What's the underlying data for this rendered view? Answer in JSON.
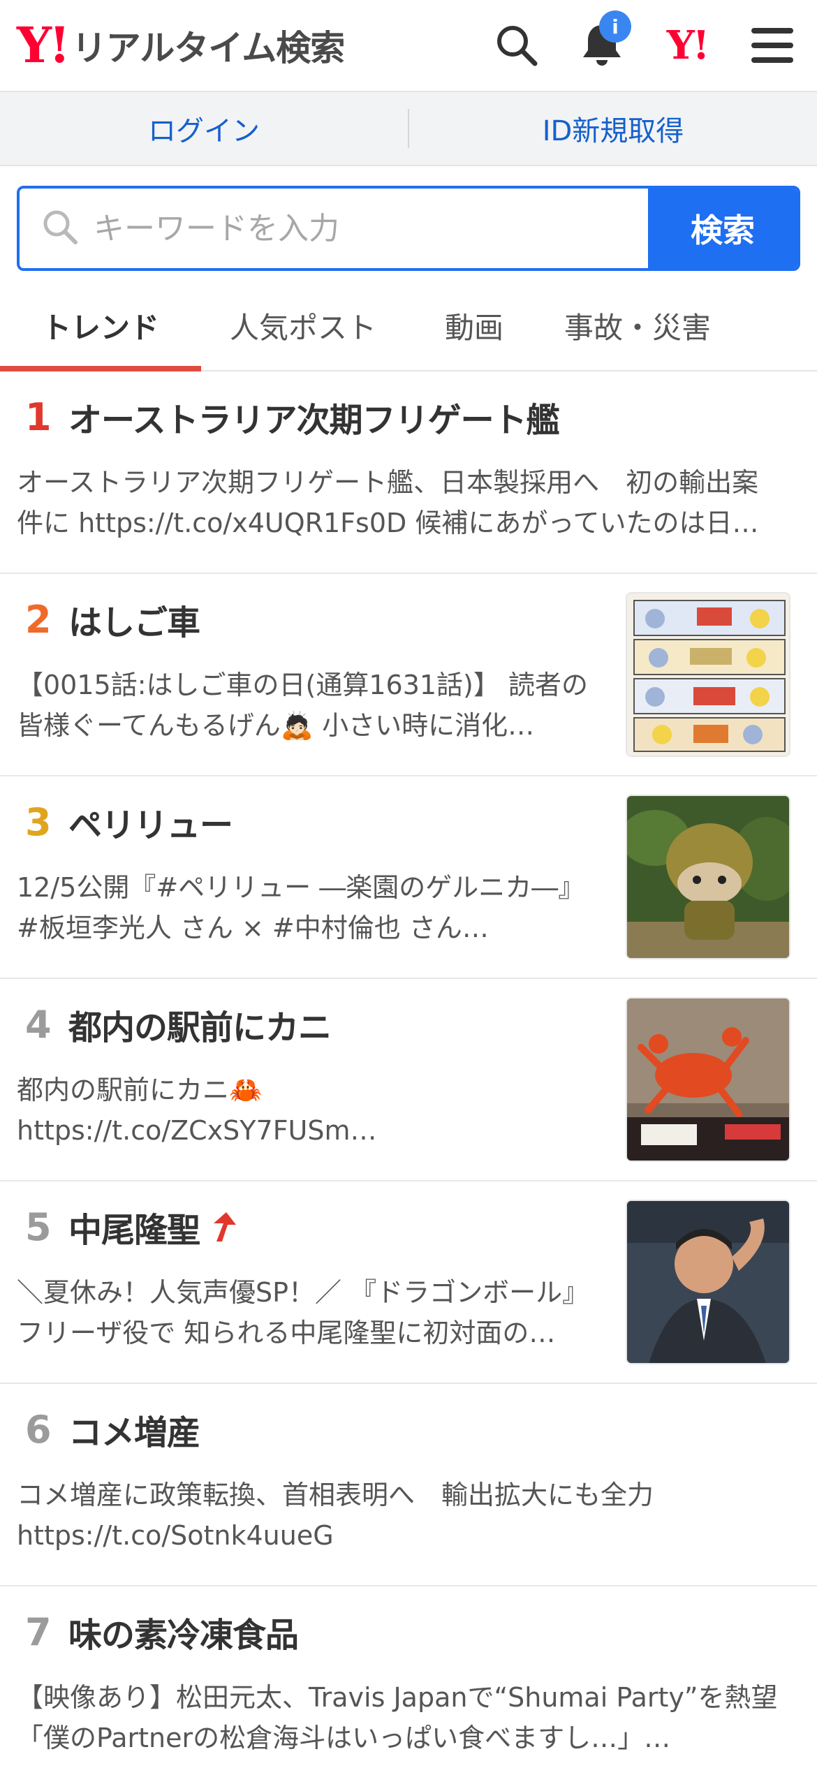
{
  "header": {
    "logo_mark": "Y!",
    "logo_text": "リアルタイム検索",
    "notification_badge": "i",
    "yj_mark": "Y!"
  },
  "login_bar": {
    "login": "ログイン",
    "register": "ID新規取得"
  },
  "search": {
    "placeholder": "キーワードを入力",
    "button": "検索"
  },
  "tabs": [
    {
      "label": "トレンド",
      "active": true
    },
    {
      "label": "人気ポスト",
      "active": false
    },
    {
      "label": "動画",
      "active": false
    },
    {
      "label": "事故・災害",
      "active": false
    }
  ],
  "trends": [
    {
      "rank": "1",
      "title": "オーストラリア次期フリゲート艦",
      "desc": "オーストラリア次期フリゲート艦、日本製採用へ　初の輸出案件に https://t.co/x4UQR1Fs0D 候補にあがっていたのは日本とドイツ…"
    },
    {
      "rank": "2",
      "title": "はしご車",
      "desc": "【0015話:はしご車の日(通算1631話)】 読者の皆様ぐーてんもるげん🙇🏻 小さい時に消化…"
    },
    {
      "rank": "3",
      "title": "ペリリュー",
      "desc": "12/5公開『#ペリリュー ―楽園のゲルニカ―』 #板垣李光人 さん × #中村倫也 さん…"
    },
    {
      "rank": "4",
      "title": "都内の駅前にカニ",
      "desc": "都内の駅前にカニ🦀 https://t.co/ZCxSY7FUSm…"
    },
    {
      "rank": "5",
      "title": "中尾隆聖",
      "desc": "＼夏休み！人気声優SP！／ 『ドラゴンボール』フリーザ役で 知られる中尾隆聖に初対面の…"
    },
    {
      "rank": "6",
      "title": "コメ増産",
      "desc": "コメ増産に政策転換、首相表明へ　輸出拡大にも全力 https://t.co/Sotnk4uueG"
    },
    {
      "rank": "7",
      "title": "味の素冷凍食品",
      "desc": "【映像あり】松田元太、Travis Japanで“Shumai Party”を熱望「僕のPartnerの松倉海斗はいっぱい食べますし…」…"
    }
  ],
  "colors": {
    "brand_red": "#ff0033",
    "accent_blue": "#1e6ff2",
    "tab_underline": "#e04b3f"
  }
}
